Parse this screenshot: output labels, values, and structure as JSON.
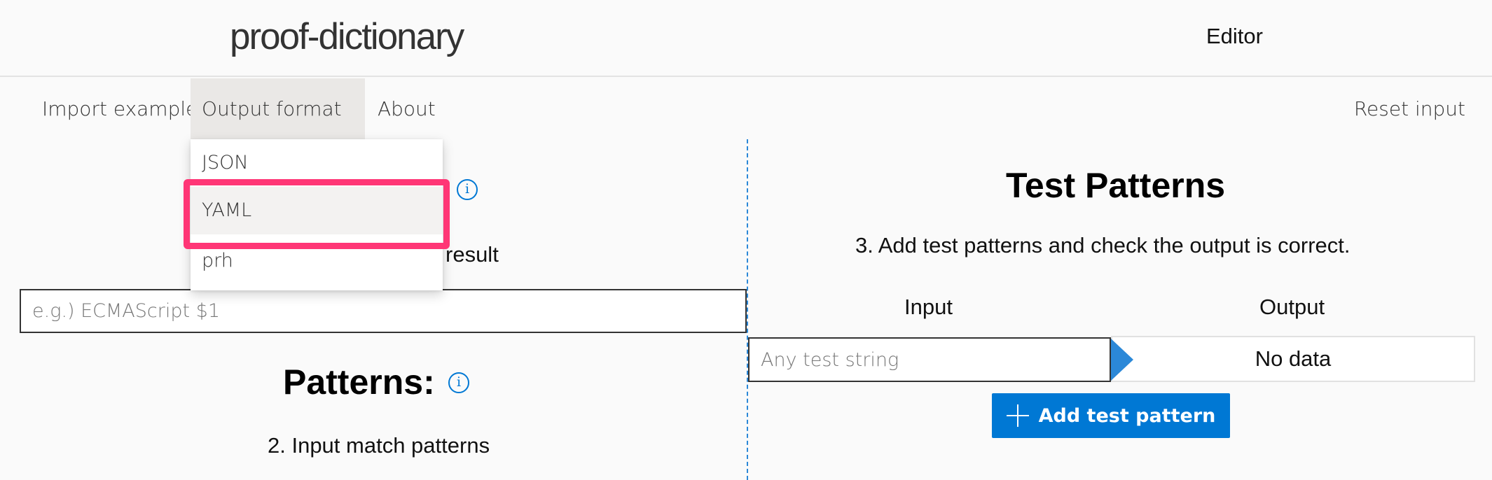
{
  "header": {
    "title": "proof-dictionary",
    "nav_link": "Editor"
  },
  "command_bar": {
    "import_example": "Import example",
    "output_format": "Output format",
    "about": "About",
    "reset_input": "Reset input"
  },
  "output_format_menu": {
    "options": [
      "JSON",
      "YAML",
      "prh"
    ],
    "highlighted": "YAML"
  },
  "left_panel": {
    "replace_hint_fragment": "result",
    "replace_placeholder": "e.g.) ECMAScript $1",
    "patterns_heading": "Patterns:",
    "patterns_instruction": "2. Input match patterns"
  },
  "right_panel": {
    "heading": "Test Patterns",
    "instruction": "3. Add test patterns and check the output is correct.",
    "input_column": "Input",
    "output_column": "Output",
    "test_input_placeholder": "Any test string",
    "output_value": "No data",
    "add_button": "Add test pattern"
  },
  "colors": {
    "accent": "#0078d4",
    "highlight": "#ff3676",
    "divider": "#2b88d8"
  },
  "icons": [
    "info-icon",
    "chevron-down-icon",
    "add-icon",
    "arrow-right-icon"
  ]
}
